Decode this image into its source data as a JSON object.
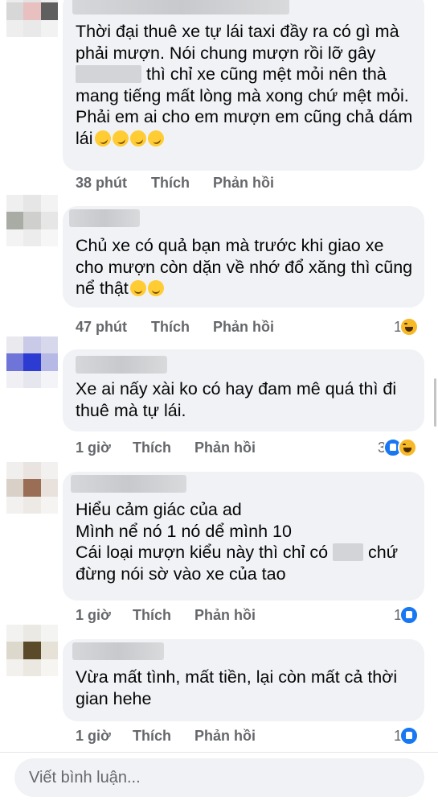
{
  "comments": [
    {
      "text_before": "Thời đại thuê xe tự lái taxi đầy ra có gì mà phải mượn. Nói chung mượn rồi lỡ gây ",
      "text_after": " thì chỉ xe cũng mệt mỏi nên thà mang tiếng mất lòng mà xong chứ mệt mỏi. Phải em ai cho em mượn em cũng chả dám lái",
      "time": "38 phút",
      "like": "Thích",
      "reply": "Phản hồi",
      "reaction_count": "",
      "reactions": []
    },
    {
      "text_before": "Chủ xe có quả bạn mà trước khi giao xe cho mượn còn dặn về nhớ đổ xăng thì cũng nể thật",
      "text_after": "",
      "time": "47 phút",
      "like": "Thích",
      "reply": "Phản hồi",
      "reaction_count": "1",
      "reactions": [
        "haha-icon"
      ]
    },
    {
      "text_before": "Xe ai nấy xài ko có hay đam mê quá thì đi thuê mà tự lái.",
      "text_after": "",
      "time": "1 giờ",
      "like": "Thích",
      "reply": "Phản hồi",
      "reaction_count": "3",
      "reactions": [
        "like-icon",
        "haha-icon"
      ]
    },
    {
      "text_before": "Hiểu cảm giác của ad\nMình nể nó 1 nó dể mình 10\nCái loại mượn kiểu này thì chỉ có ",
      "text_after": " chứ\nđừng nói sờ vào xe của tao",
      "time": "1 giờ",
      "like": "Thích",
      "reply": "Phản hồi",
      "reaction_count": "1",
      "reactions": [
        "like-icon"
      ]
    },
    {
      "text_before": "Vừa mất tình, mất tiền, lại còn mất cả thời gian hehe",
      "text_after": "",
      "time": "1 giờ",
      "like": "Thích",
      "reply": "Phản hồi",
      "reaction_count": "1",
      "reactions": [
        "like-icon"
      ]
    }
  ],
  "composer": {
    "placeholder": "Viết bình luận..."
  },
  "colors": {
    "bubble": "#f0f2f5",
    "like_blue": "#1877f2",
    "haha_yellow": "#f7b928",
    "meta_gray": "#65676b"
  }
}
